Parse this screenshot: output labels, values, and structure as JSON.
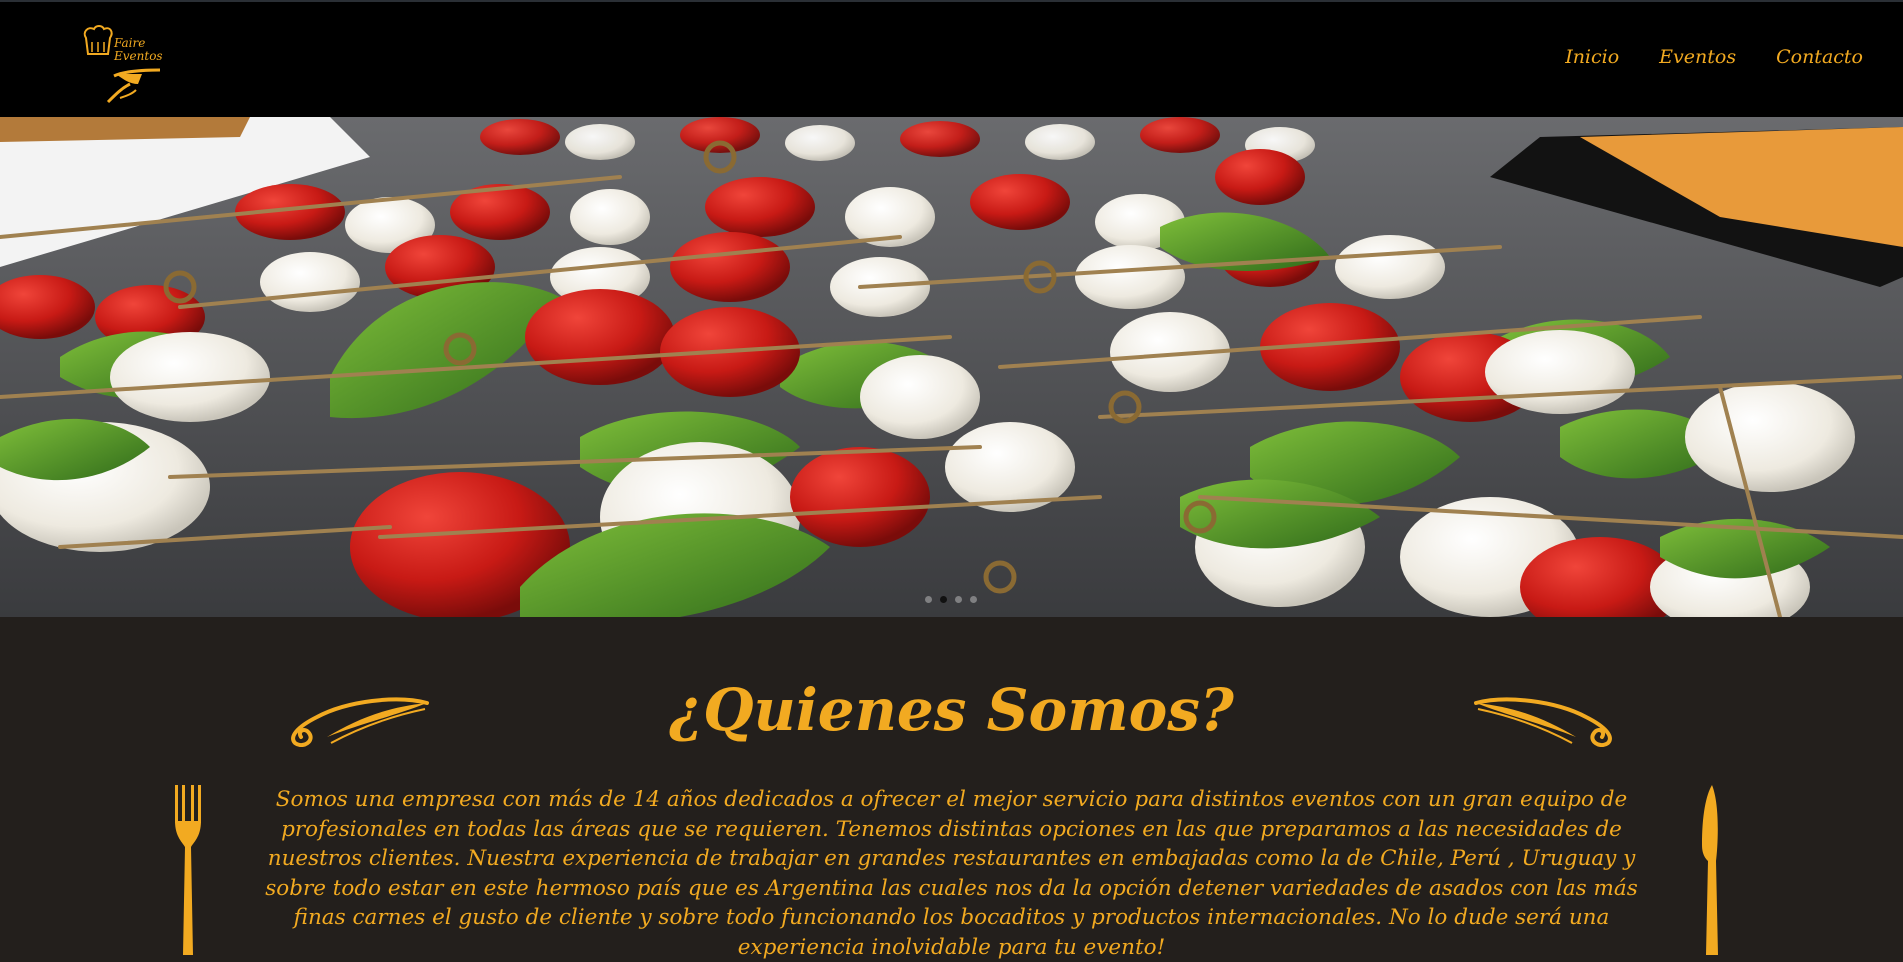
{
  "header": {
    "logo": {
      "line1": "Faire",
      "line2": "Eventos",
      "icon": "chef-hat-waiter-icon"
    },
    "nav": [
      {
        "label": "Inicio"
      },
      {
        "label": "Eventos"
      },
      {
        "label": "Contacto"
      }
    ]
  },
  "hero": {
    "image": "caprese-skewers-tray-photo",
    "slides": 4,
    "active_slide": 2
  },
  "about": {
    "title": "¿Quienes Somos?",
    "paragraph": "Somos una empresa con más de 14 años dedicados a ofrecer el mejor servicio para distintos eventos con un gran equipo de profesionales en todas las áreas que se requieren. Tenemos distintas opciones en las que preparamos a las necesidades de nuestros clientes. Nuestra experiencia de trabajar en grandes restaurantes en embajadas como la de Chile, Perú , Uruguay y sobre todo estar en este hermoso país que es Argentina las cuales nos da la opción detener variedades de asados con las más finas carnes el gusto de cliente y sobre todo funcionando los bocaditos y productos internacionales. No lo dude será una experiencia inolvidable para tu evento!"
  },
  "colors": {
    "accent": "#f2aa21",
    "header_bg": "#000000",
    "section_bg": "#231f1c"
  }
}
